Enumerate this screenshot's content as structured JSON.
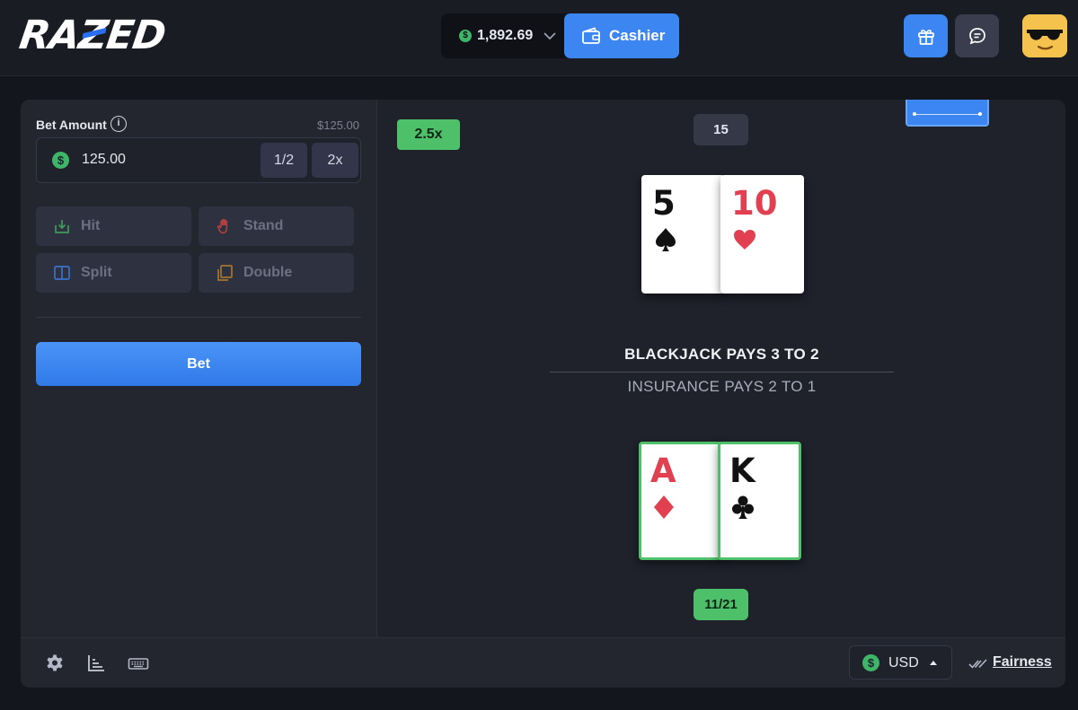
{
  "header": {
    "logo": "RAZED",
    "balance": "1,892.69",
    "cashier_label": "Cashier"
  },
  "bet_panel": {
    "bet_amount_label": "Bet Amount",
    "info_symbol": "i",
    "bet_usd_value": "$125.00",
    "bet_amount_value": "125.00",
    "half_label": "1/2",
    "double_amount_label": "2x",
    "actions": {
      "hit": "Hit",
      "stand": "Stand",
      "split": "Split",
      "double": "Double"
    },
    "bet_button_label": "Bet"
  },
  "table": {
    "multiplier": "2.5x",
    "dealer_score": "15",
    "player_score": "11/21",
    "rules_title": "BLACKJACK PAYS 3 TO 2",
    "rules_sub": "INSURANCE PAYS 2 TO 1",
    "dealer_cards": [
      {
        "rank": "5",
        "suit": "spade"
      },
      {
        "rank": "10",
        "suit": "heart"
      }
    ],
    "player_cards": [
      {
        "rank": "A",
        "suit": "diamond"
      },
      {
        "rank": "K",
        "suit": "club"
      }
    ]
  },
  "footer": {
    "currency": "USD",
    "fairness_label": "Fairness"
  },
  "colors": {
    "accent_blue": "#3b86f0",
    "win_green": "#4fc06a",
    "card_red": "#e0404f",
    "coin_green": "#3fb56a"
  }
}
